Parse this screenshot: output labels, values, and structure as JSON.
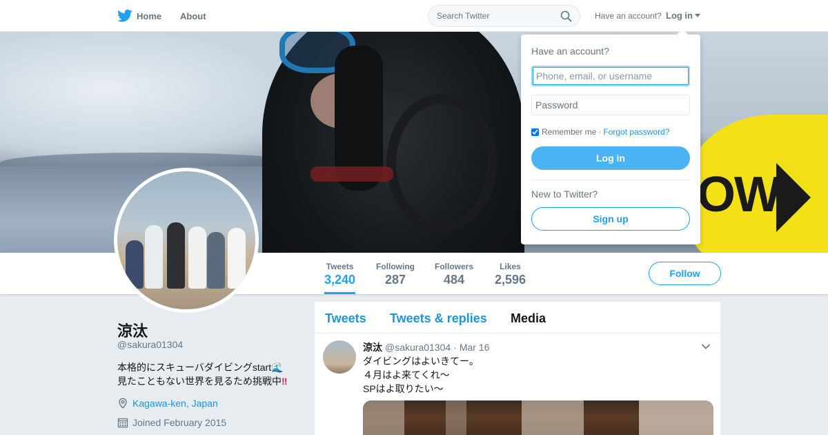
{
  "topbar": {
    "home_label": "Home",
    "about_label": "About",
    "search_placeholder": "Search Twitter",
    "have_account": "Have an account?",
    "login_label": "Log in",
    "brand_color": "#1da1f2"
  },
  "banner": {
    "buoy_text": "OW"
  },
  "profile_nav": {
    "stats": [
      {
        "label": "Tweets",
        "value": "3,240",
        "active": true
      },
      {
        "label": "Following",
        "value": "287",
        "active": false
      },
      {
        "label": "Followers",
        "value": "484",
        "active": false
      },
      {
        "label": "Likes",
        "value": "2,596",
        "active": false
      }
    ],
    "follow_label": "Follow"
  },
  "profile": {
    "name": "涼汰",
    "handle": "@sakura01304",
    "bio_line1": "本格的にスキューバダイビングstart",
    "bio_line1_emoji": "🌊",
    "bio_line2": "見たこともない世界を見るため挑戦中",
    "bio_line2_emoji": "‼",
    "location": "Kagawa-ken, Japan",
    "joined": "Joined February 2015"
  },
  "timeline": {
    "tabs": [
      {
        "label": "Tweets",
        "current": false
      },
      {
        "label": "Tweets & replies",
        "current": false
      },
      {
        "label": "Media",
        "current": true
      }
    ],
    "tweet": {
      "name": "涼汰",
      "handle": "@sakura01304",
      "dot": "·",
      "date": "Mar 16",
      "lines": [
        "ダイビングはよいきてー。",
        "４月はよ来てくれ～",
        "SPはよ取りたい～"
      ]
    }
  },
  "login_dropdown": {
    "title": "Have an account?",
    "username_placeholder": "Phone, email, or username",
    "password_placeholder": "Password",
    "remember_label": "Remember me",
    "separator": "·",
    "forgot_label": "Forgot password?",
    "login_button": "Log in",
    "new_label": "New to Twitter?",
    "signup_button": "Sign up",
    "remember_checked": true
  }
}
